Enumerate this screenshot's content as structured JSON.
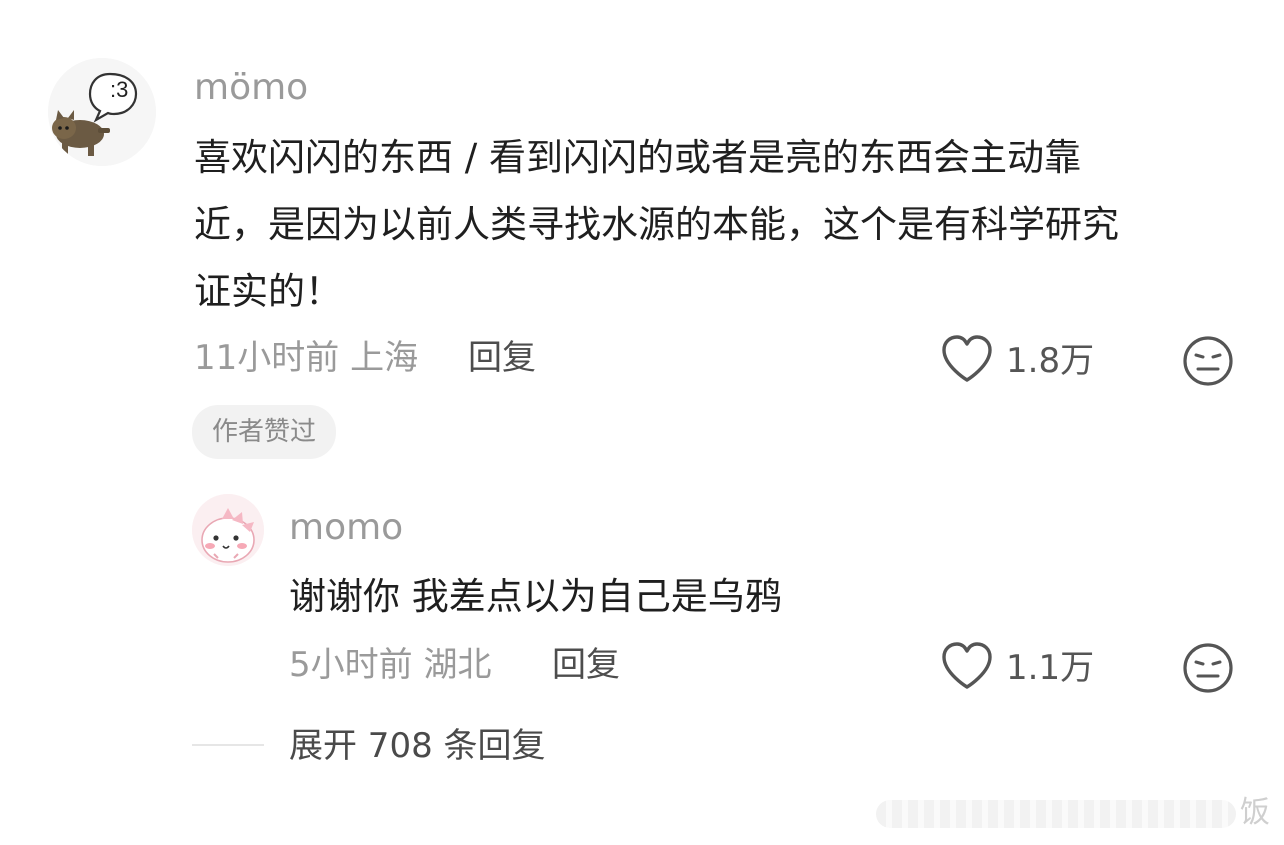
{
  "comment": {
    "username": "mömo",
    "avatar_bubble_text": ":3",
    "lines": [
      "喜欢闪闪的东西 / 看到闪闪的或者是亮的东西会主动靠",
      "近，是因为以前人类寻找水源的本能，这个是有科学研究",
      "证实的！"
    ],
    "meta": "11小时前 上海",
    "reply_label": "回复",
    "likes": "1.8万",
    "badge": "作者赞过"
  },
  "reply": {
    "username": "momo",
    "text": "谢谢你 我差点以为自己是乌鸦",
    "meta": "5小时前 湖北",
    "reply_label": "回复",
    "likes": "1.1万"
  },
  "expand_label": "展开 708 条回复",
  "watermark": "饭",
  "icons": {
    "like": "heart-outline-icon",
    "dislike": "meh-face-icon"
  },
  "colors": {
    "text_primary": "#1f1f1f",
    "text_secondary": "#9a9a9a",
    "badge_bg": "#f2f2f2"
  }
}
